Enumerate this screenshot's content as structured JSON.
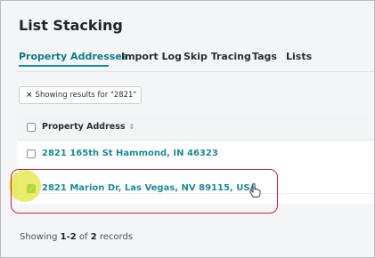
{
  "page": {
    "title": "List Stacking"
  },
  "tabs": [
    "Property Addresses",
    "Import Log",
    "Skip Tracing",
    "Tags",
    "Lists"
  ],
  "filter_chip": {
    "close_glyph": "×",
    "label": "Showing results for \"2821\""
  },
  "table": {
    "header": {
      "label": "Property Address",
      "sort_glyph": "⇕"
    },
    "rows": [
      {
        "address": "2821 165th St Hammond, IN 46323",
        "checked": false
      },
      {
        "address": "2821 Marion Dr, Las Vegas, NV 89115, USA",
        "checked": true
      }
    ]
  },
  "footer": {
    "prefix": "Showing",
    "range": "1-2",
    "of": "of",
    "total": "2",
    "suffix": "records"
  },
  "colors": {
    "accent": "#0f8a9a",
    "checkbox_checked": "#2e9a4a",
    "annotation": "#c8283a",
    "highlight": "#e2e63c"
  },
  "icons": {
    "checked_glyph": "✓"
  }
}
